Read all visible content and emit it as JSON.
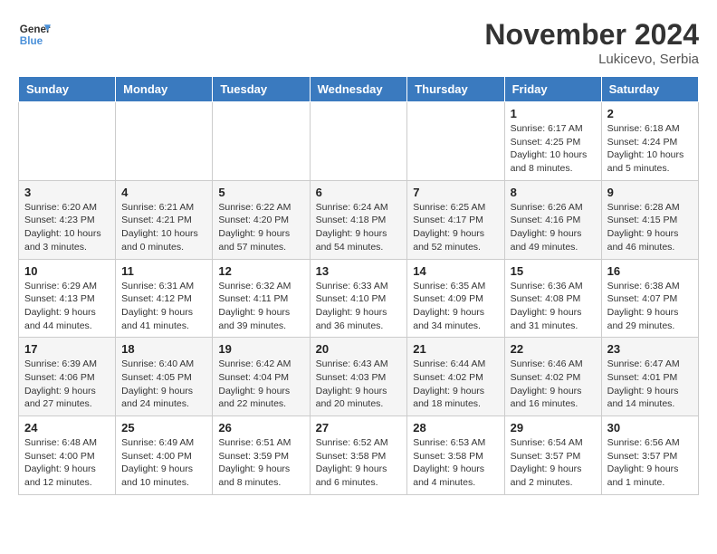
{
  "header": {
    "logo_line1": "General",
    "logo_line2": "Blue",
    "month": "November 2024",
    "location": "Lukicevo, Serbia"
  },
  "weekdays": [
    "Sunday",
    "Monday",
    "Tuesday",
    "Wednesday",
    "Thursday",
    "Friday",
    "Saturday"
  ],
  "weeks": [
    [
      {
        "day": "",
        "info": ""
      },
      {
        "day": "",
        "info": ""
      },
      {
        "day": "",
        "info": ""
      },
      {
        "day": "",
        "info": ""
      },
      {
        "day": "",
        "info": ""
      },
      {
        "day": "1",
        "info": "Sunrise: 6:17 AM\nSunset: 4:25 PM\nDaylight: 10 hours\nand 8 minutes."
      },
      {
        "day": "2",
        "info": "Sunrise: 6:18 AM\nSunset: 4:24 PM\nDaylight: 10 hours\nand 5 minutes."
      }
    ],
    [
      {
        "day": "3",
        "info": "Sunrise: 6:20 AM\nSunset: 4:23 PM\nDaylight: 10 hours\nand 3 minutes."
      },
      {
        "day": "4",
        "info": "Sunrise: 6:21 AM\nSunset: 4:21 PM\nDaylight: 10 hours\nand 0 minutes."
      },
      {
        "day": "5",
        "info": "Sunrise: 6:22 AM\nSunset: 4:20 PM\nDaylight: 9 hours\nand 57 minutes."
      },
      {
        "day": "6",
        "info": "Sunrise: 6:24 AM\nSunset: 4:18 PM\nDaylight: 9 hours\nand 54 minutes."
      },
      {
        "day": "7",
        "info": "Sunrise: 6:25 AM\nSunset: 4:17 PM\nDaylight: 9 hours\nand 52 minutes."
      },
      {
        "day": "8",
        "info": "Sunrise: 6:26 AM\nSunset: 4:16 PM\nDaylight: 9 hours\nand 49 minutes."
      },
      {
        "day": "9",
        "info": "Sunrise: 6:28 AM\nSunset: 4:15 PM\nDaylight: 9 hours\nand 46 minutes."
      }
    ],
    [
      {
        "day": "10",
        "info": "Sunrise: 6:29 AM\nSunset: 4:13 PM\nDaylight: 9 hours\nand 44 minutes."
      },
      {
        "day": "11",
        "info": "Sunrise: 6:31 AM\nSunset: 4:12 PM\nDaylight: 9 hours\nand 41 minutes."
      },
      {
        "day": "12",
        "info": "Sunrise: 6:32 AM\nSunset: 4:11 PM\nDaylight: 9 hours\nand 39 minutes."
      },
      {
        "day": "13",
        "info": "Sunrise: 6:33 AM\nSunset: 4:10 PM\nDaylight: 9 hours\nand 36 minutes."
      },
      {
        "day": "14",
        "info": "Sunrise: 6:35 AM\nSunset: 4:09 PM\nDaylight: 9 hours\nand 34 minutes."
      },
      {
        "day": "15",
        "info": "Sunrise: 6:36 AM\nSunset: 4:08 PM\nDaylight: 9 hours\nand 31 minutes."
      },
      {
        "day": "16",
        "info": "Sunrise: 6:38 AM\nSunset: 4:07 PM\nDaylight: 9 hours\nand 29 minutes."
      }
    ],
    [
      {
        "day": "17",
        "info": "Sunrise: 6:39 AM\nSunset: 4:06 PM\nDaylight: 9 hours\nand 27 minutes."
      },
      {
        "day": "18",
        "info": "Sunrise: 6:40 AM\nSunset: 4:05 PM\nDaylight: 9 hours\nand 24 minutes."
      },
      {
        "day": "19",
        "info": "Sunrise: 6:42 AM\nSunset: 4:04 PM\nDaylight: 9 hours\nand 22 minutes."
      },
      {
        "day": "20",
        "info": "Sunrise: 6:43 AM\nSunset: 4:03 PM\nDaylight: 9 hours\nand 20 minutes."
      },
      {
        "day": "21",
        "info": "Sunrise: 6:44 AM\nSunset: 4:02 PM\nDaylight: 9 hours\nand 18 minutes."
      },
      {
        "day": "22",
        "info": "Sunrise: 6:46 AM\nSunset: 4:02 PM\nDaylight: 9 hours\nand 16 minutes."
      },
      {
        "day": "23",
        "info": "Sunrise: 6:47 AM\nSunset: 4:01 PM\nDaylight: 9 hours\nand 14 minutes."
      }
    ],
    [
      {
        "day": "24",
        "info": "Sunrise: 6:48 AM\nSunset: 4:00 PM\nDaylight: 9 hours\nand 12 minutes."
      },
      {
        "day": "25",
        "info": "Sunrise: 6:49 AM\nSunset: 4:00 PM\nDaylight: 9 hours\nand 10 minutes."
      },
      {
        "day": "26",
        "info": "Sunrise: 6:51 AM\nSunset: 3:59 PM\nDaylight: 9 hours\nand 8 minutes."
      },
      {
        "day": "27",
        "info": "Sunrise: 6:52 AM\nSunset: 3:58 PM\nDaylight: 9 hours\nand 6 minutes."
      },
      {
        "day": "28",
        "info": "Sunrise: 6:53 AM\nSunset: 3:58 PM\nDaylight: 9 hours\nand 4 minutes."
      },
      {
        "day": "29",
        "info": "Sunrise: 6:54 AM\nSunset: 3:57 PM\nDaylight: 9 hours\nand 2 minutes."
      },
      {
        "day": "30",
        "info": "Sunrise: 6:56 AM\nSunset: 3:57 PM\nDaylight: 9 hours\nand 1 minute."
      }
    ]
  ]
}
